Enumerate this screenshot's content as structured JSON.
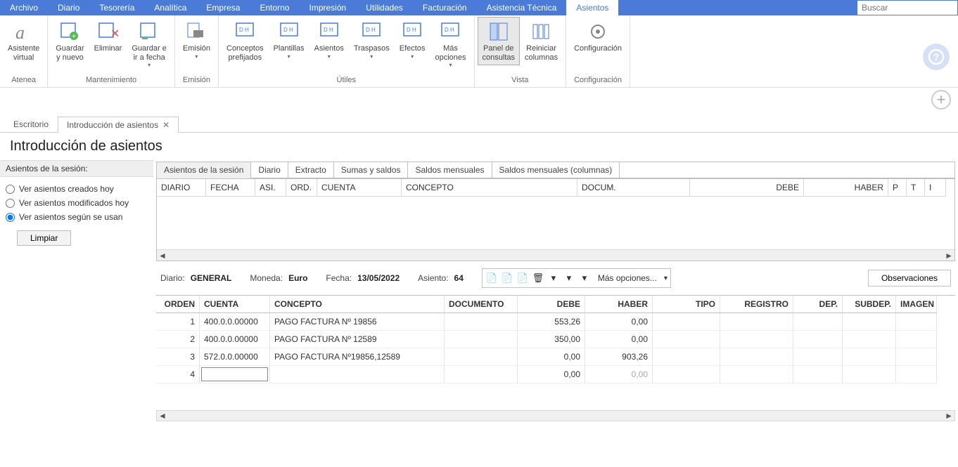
{
  "menubar": [
    "Archivo",
    "Diario",
    "Tesorería",
    "Analítica",
    "Empresa",
    "Entorno",
    "Impresión",
    "Utilidades",
    "Facturación",
    "Asistencia Técnica",
    "Asientos"
  ],
  "menubar_active": 10,
  "search": {
    "placeholder": "Buscar"
  },
  "ribbon": {
    "groups": [
      {
        "label": "Atenea",
        "items": [
          {
            "name": "asistente-virtual",
            "text": "Asistente\nvirtual"
          }
        ]
      },
      {
        "label": "Mantenimiento",
        "items": [
          {
            "name": "guardar-nuevo",
            "text": "Guardar\ny nuevo"
          },
          {
            "name": "eliminar",
            "text": "Eliminar"
          },
          {
            "name": "guardar-ir-fecha",
            "text": "Guardar e\nir a fecha",
            "drop": true
          }
        ]
      },
      {
        "label": "Emisión",
        "items": [
          {
            "name": "emision",
            "text": "Emisión",
            "drop": true
          }
        ]
      },
      {
        "label": "Útiles",
        "items": [
          {
            "name": "conceptos-prefijados",
            "text": "Conceptos\nprefijados"
          },
          {
            "name": "plantillas",
            "text": "Plantillas",
            "drop": true
          },
          {
            "name": "asientos",
            "text": "Asientos",
            "drop": true
          },
          {
            "name": "traspasos",
            "text": "Traspasos",
            "drop": true
          },
          {
            "name": "efectos",
            "text": "Efectos",
            "drop": true
          },
          {
            "name": "mas-opciones",
            "text": "Más\nopciones",
            "drop": true
          }
        ]
      },
      {
        "label": "Vista",
        "items": [
          {
            "name": "panel-consultas",
            "text": "Panel de\nconsultas",
            "active": true
          },
          {
            "name": "reiniciar-columnas",
            "text": "Reiniciar\ncolumnas"
          }
        ]
      },
      {
        "label": "Configuración",
        "items": [
          {
            "name": "configuracion",
            "text": "Configuración"
          }
        ]
      }
    ]
  },
  "doc_tabs": [
    {
      "name": "escritorio",
      "label": "Escritorio",
      "closable": false
    },
    {
      "name": "introduccion-asientos",
      "label": "Introducción de asientos",
      "closable": true,
      "active": true
    }
  ],
  "page_title": "Introducción de asientos",
  "side": {
    "header": "Asientos de la sesión:",
    "options": [
      {
        "name": "ver-creados-hoy",
        "label": "Ver asientos creados hoy"
      },
      {
        "name": "ver-modificados-hoy",
        "label": "Ver asientos modificados hoy"
      },
      {
        "name": "ver-segun-se-usan",
        "label": "Ver asientos según se usan",
        "checked": true
      }
    ],
    "clear_btn": "Limpiar"
  },
  "inner_tabs": [
    "Asientos de la sesión",
    "Diario",
    "Extracto",
    "Sumas y saldos",
    "Saldos mensuales",
    "Saldos mensuales (columnas)"
  ],
  "inner_tabs_active": 0,
  "grid1_headers": [
    "DIARIO",
    "FECHA",
    "ASI.",
    "ORD.",
    "CUENTA",
    "CONCEPTO",
    "DOCUM.",
    "DEBE",
    "HABER",
    "P",
    "T",
    "I"
  ],
  "info": {
    "diario_lbl": "Diario:",
    "diario": "GENERAL",
    "moneda_lbl": "Moneda:",
    "moneda": "Euro",
    "fecha_lbl": "Fecha:",
    "fecha": "13/05/2022",
    "asiento_lbl": "Asiento:",
    "asiento": "64",
    "mas_opciones": "Más opciones...",
    "observaciones": "Observaciones"
  },
  "grid2_headers": [
    "ORDEN",
    "CUENTA",
    "CONCEPTO",
    "DOCUMENTO",
    "DEBE",
    "HABER",
    "TIPO",
    "REGISTRO",
    "DEP.",
    "SUBDEP.",
    "IMAGEN"
  ],
  "grid2_rows": [
    {
      "orden": "1",
      "cuenta": "400.0.0.00000",
      "concepto": "PAGO FACTURA Nº 19856",
      "documento": "",
      "debe": "553,26",
      "haber": "0,00",
      "tipo": "",
      "registro": "",
      "dep": "",
      "subdep": "",
      "imagen": ""
    },
    {
      "orden": "2",
      "cuenta": "400.0.0.00000",
      "concepto": "PAGO FACTURA Nº 12589",
      "documento": "",
      "debe": "350,00",
      "haber": "0,00",
      "tipo": "",
      "registro": "",
      "dep": "",
      "subdep": "",
      "imagen": ""
    },
    {
      "orden": "3",
      "cuenta": "572.0.0.00000",
      "concepto": "PAGO FACTURA Nº19856,12589",
      "documento": "",
      "debe": "0,00",
      "haber": "903,26",
      "tipo": "",
      "registro": "",
      "dep": "",
      "subdep": "",
      "imagen": ""
    },
    {
      "orden": "4",
      "cuenta": "",
      "concepto": "",
      "documento": "",
      "debe": "0,00",
      "haber": "0,00",
      "haber_dim": true,
      "editable": true
    }
  ]
}
